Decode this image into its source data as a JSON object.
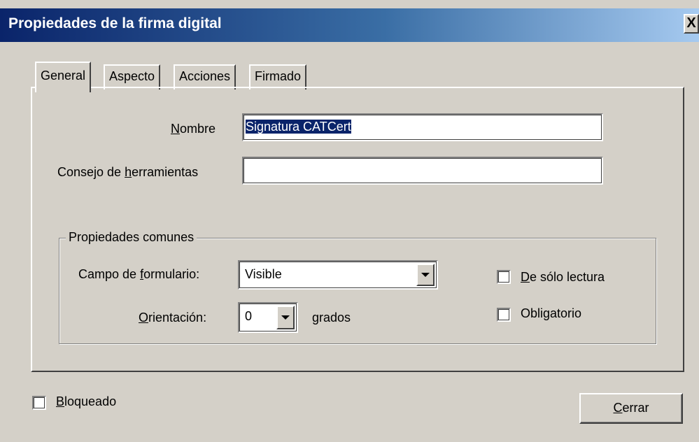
{
  "window": {
    "title": "Propiedades de la firma digital",
    "close_label": "X"
  },
  "tabs": [
    {
      "label": "General",
      "active": true
    },
    {
      "label": "Aspecto",
      "active": false
    },
    {
      "label": "Acciones",
      "active": false
    },
    {
      "label": "Firmado",
      "active": false
    }
  ],
  "form": {
    "name": {
      "label_pre": "",
      "label_u": "N",
      "label_post": "ombre",
      "value": "Signatura CATCert"
    },
    "tooltip": {
      "label_pre": "Consejo de ",
      "label_u": "h",
      "label_post": "erramientas",
      "value": ""
    }
  },
  "common": {
    "legend": "Propiedades comunes",
    "form_field": {
      "label_pre": "Campo de ",
      "label_u": "f",
      "label_post": "ormulario:",
      "value": "Visible"
    },
    "orientation": {
      "label_pre": "",
      "label_u": "O",
      "label_post": "rientación:",
      "value": "0",
      "unit": "grados"
    },
    "readonly": {
      "label_pre": "",
      "label_u": "D",
      "label_post": "e sólo lectura",
      "checked": false
    },
    "required": {
      "label_pre": "Obli",
      "label_u": "g",
      "label_post": "atorio",
      "checked": false
    }
  },
  "footer": {
    "locked": {
      "label_pre": "",
      "label_u": "B",
      "label_post": "loqueado",
      "checked": false
    },
    "close_button": {
      "label_pre": "",
      "label_u": "C",
      "label_post": "errar"
    }
  },
  "colors": {
    "title_bar": "#0a246a",
    "face": "#d4d0c8",
    "selection": "#0a246a"
  }
}
